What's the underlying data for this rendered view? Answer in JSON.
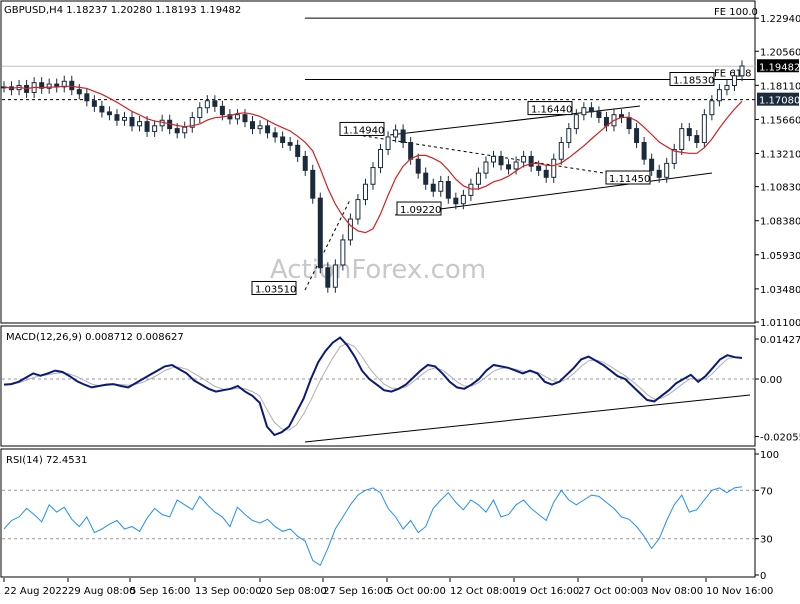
{
  "chart_data": [
    {
      "type": "candlestick",
      "title": "GBPUSD,H4  1.18237 1.20280 1.18193 1.19482",
      "watermark": "ActionForex.com",
      "y_ticks": [
        "1.22940",
        "1.20560",
        "1.18110",
        "1.15660",
        "1.13210",
        "1.10830",
        "1.08380",
        "1.05930",
        "1.03480",
        "1.01100"
      ],
      "y_range": [
        1.011,
        1.241
      ],
      "x_ticks": [
        "22 Aug 2022",
        "29 Aug 08:00",
        "5 Sep 16:00",
        "13 Sep 00:00",
        "20 Sep 08:00",
        "27 Sep 16:00",
        "5 Oct 00:00",
        "12 Oct 08:00",
        "19 Oct 16:00",
        "27 Oct 00:00",
        "3 Nov 08:00",
        "10 Nov 16:00"
      ],
      "current_price": "1.19482",
      "support_level": "1.17080",
      "fibo": [
        {
          "label": "FE 100.0",
          "value": 1.2294
        },
        {
          "label": "FE 61.8",
          "value": 1.1853
        }
      ],
      "price_labels": [
        {
          "label": "1.18530",
          "value": 1.1853
        },
        {
          "label": "1.16440",
          "value": 1.1644
        },
        {
          "label": "1.14940",
          "value": 1.1494
        },
        {
          "label": "1.11450",
          "value": 1.1145
        },
        {
          "label": "1.09220",
          "value": 1.0922
        },
        {
          "label": "1.03510",
          "value": 1.0351
        }
      ],
      "close_path": [
        1.18,
        1.178,
        1.181,
        1.176,
        1.183,
        1.179,
        1.182,
        1.18,
        1.184,
        1.178,
        1.175,
        1.17,
        1.166,
        1.162,
        1.16,
        1.156,
        1.158,
        1.152,
        1.155,
        1.148,
        1.152,
        1.156,
        1.15,
        1.147,
        1.151,
        1.158,
        1.165,
        1.17,
        1.166,
        1.16,
        1.157,
        1.16,
        1.155,
        1.15,
        1.152,
        1.147,
        1.144,
        1.14,
        1.138,
        1.13,
        1.12,
        1.1,
        1.05,
        1.036,
        1.052,
        1.07,
        1.085,
        1.099,
        1.11,
        1.122,
        1.135,
        1.144,
        1.149,
        1.14,
        1.128,
        1.118,
        1.11,
        1.105,
        1.112,
        1.1,
        1.096,
        1.102,
        1.11,
        1.118,
        1.126,
        1.13,
        1.124,
        1.121,
        1.126,
        1.13,
        1.123,
        1.12,
        1.115,
        1.128,
        1.14,
        1.15,
        1.16,
        1.165,
        1.162,
        1.158,
        1.152,
        1.16,
        1.158,
        1.15,
        1.14,
        1.128,
        1.12,
        1.115,
        1.125,
        1.135,
        1.15,
        1.145,
        1.14,
        1.16,
        1.17,
        1.178,
        1.181,
        1.188,
        1.195
      ]
    },
    {
      "type": "line",
      "title": "MACD(12,26,9) 0.008712 0.008627",
      "y_ticks": [
        "0.014278",
        "0.00",
        "-0.020556"
      ],
      "y_range": [
        -0.0232,
        0.0175
      ],
      "macd": [
        -0.002,
        -0.0018,
        -0.001,
        0.0005,
        0.002,
        0.0012,
        0.002,
        0.003,
        0.0025,
        0.001,
        -0.0008,
        -0.002,
        -0.003,
        -0.0025,
        -0.002,
        -0.0018,
        -0.0025,
        -0.003,
        -0.0015,
        0.0,
        0.0015,
        0.003,
        0.0045,
        0.005,
        0.0035,
        0.002,
        -0.0005,
        -0.002,
        -0.0035,
        -0.0045,
        -0.004,
        -0.0035,
        -0.0025,
        -0.0045,
        -0.006,
        -0.0085,
        -0.017,
        -0.02,
        -0.019,
        -0.017,
        -0.012,
        -0.007,
        0.0,
        0.006,
        0.01,
        0.013,
        0.0148,
        0.012,
        0.008,
        0.003,
        0.0,
        -0.002,
        -0.004,
        -0.0045,
        -0.0035,
        -0.002,
        0.0005,
        0.003,
        0.005,
        0.0045,
        0.002,
        -0.001,
        -0.003,
        -0.0035,
        -0.002,
        0.0,
        0.003,
        0.005,
        0.0045,
        0.004,
        0.003,
        0.002,
        0.003,
        0.002,
        -0.001,
        -0.002,
        -0.001,
        0.0015,
        0.004,
        0.007,
        0.008,
        0.0065,
        0.005,
        0.003,
        0.001,
        0.0,
        -0.0025,
        -0.005,
        -0.0075,
        -0.008,
        -0.006,
        -0.004,
        -0.0015,
        0.0,
        0.0015,
        -0.001,
        0.001,
        0.004,
        0.007,
        0.0085,
        0.0078,
        0.0075
      ],
      "signal": [
        -0.0018,
        -0.0017,
        -0.0013,
        -0.0005,
        0.0005,
        0.0012,
        0.0015,
        0.002,
        0.0023,
        0.0018,
        0.0008,
        -0.0005,
        -0.0018,
        -0.0024,
        -0.0023,
        -0.002,
        -0.002,
        -0.0022,
        -0.0019,
        -0.0012,
        0.0,
        0.0014,
        0.003,
        0.004,
        0.0042,
        0.0035,
        0.002,
        0.0005,
        -0.0012,
        -0.0028,
        -0.0036,
        -0.0037,
        -0.0033,
        -0.0035,
        -0.0045,
        -0.006,
        -0.011,
        -0.0155,
        -0.0178,
        -0.0182,
        -0.0165,
        -0.0125,
        -0.0075,
        -0.002,
        0.003,
        0.0075,
        0.0115,
        0.0128,
        0.0115,
        0.008,
        0.004,
        0.0008,
        -0.0018,
        -0.0032,
        -0.0035,
        -0.0028,
        -0.001,
        0.0012,
        0.0032,
        0.004,
        0.0032,
        0.0012,
        -0.001,
        -0.0025,
        -0.0025,
        -0.0012,
        0.0008,
        0.0028,
        0.0038,
        0.004,
        0.0035,
        0.0028,
        0.0026,
        0.0024,
        0.001,
        -0.0005,
        -0.0012,
        0.0,
        0.002,
        0.0045,
        0.0065,
        0.0068,
        0.006,
        0.0045,
        0.0028,
        0.0012,
        -0.0008,
        -0.003,
        -0.0055,
        -0.0072,
        -0.0068,
        -0.0055,
        -0.0035,
        -0.0015,
        0.0002,
        -0.0002,
        0.0,
        0.002,
        0.0048,
        0.0072,
        0.0078,
        0.0077
      ]
    },
    {
      "type": "line",
      "title": "RSI(14) 72.4531",
      "y_ticks": [
        "100",
        "70",
        "30",
        "0"
      ],
      "y_range": [
        0,
        100
      ],
      "rsi": [
        38,
        45,
        48,
        55,
        50,
        44,
        58,
        52,
        56,
        46,
        40,
        48,
        35,
        38,
        42,
        45,
        38,
        40,
        36,
        47,
        55,
        50,
        48,
        62,
        58,
        54,
        65,
        58,
        52,
        48,
        40,
        56,
        50,
        45,
        43,
        46,
        40,
        36,
        38,
        32,
        28,
        12,
        8,
        22,
        38,
        48,
        58,
        66,
        70,
        72,
        68,
        55,
        48,
        38,
        45,
        35,
        40,
        55,
        62,
        68,
        60,
        54,
        62,
        58,
        52,
        62,
        48,
        50,
        58,
        62,
        55,
        50,
        45,
        60,
        70,
        62,
        58,
        62,
        66,
        65,
        60,
        55,
        48,
        46,
        40,
        32,
        22,
        30,
        45,
        58,
        66,
        52,
        54,
        62,
        70,
        72,
        68,
        72,
        73
      ]
    }
  ]
}
